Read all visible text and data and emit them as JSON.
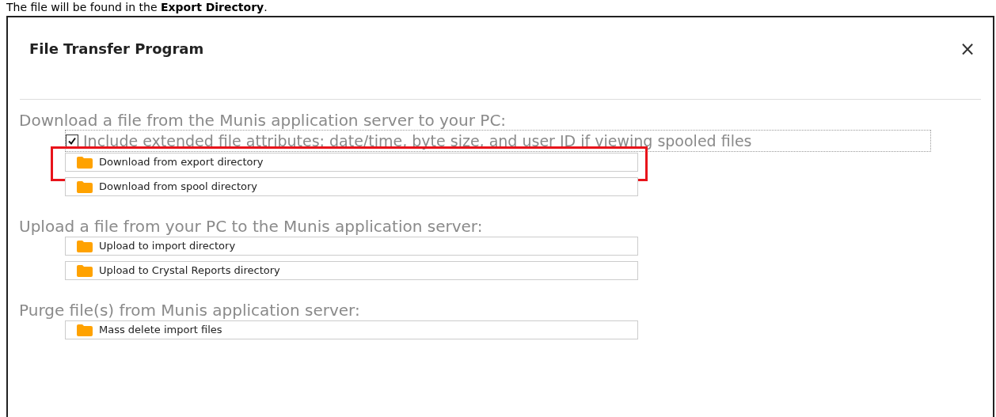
{
  "caption": "The file will be found in the **Export Directory**.",
  "dialog": {
    "title": "File Transfer Program",
    "close": "×"
  },
  "sections": [
    {
      "heading": "Download a file from the Munis application server to your PC:",
      "option": {
        "label": "Include extended file attributes: date/time, byte size, and user ID if viewing spooled files",
        "checked": true
      },
      "buttons": [
        {
          "label": "Download from export directory",
          "highlighted": true
        },
        {
          "label": "Download from spool directory",
          "highlighted": false
        }
      ]
    },
    {
      "heading": "Upload a file from your PC to the Munis application server:",
      "buttons": [
        {
          "label": "Upload to import directory",
          "highlighted": false
        },
        {
          "label": "Upload to Crystal Reports directory",
          "highlighted": false
        }
      ]
    },
    {
      "heading": "Purge file(s) from Munis application server:",
      "buttons": [
        {
          "label": "Mass delete import files",
          "highlighted": false
        }
      ]
    }
  ]
}
